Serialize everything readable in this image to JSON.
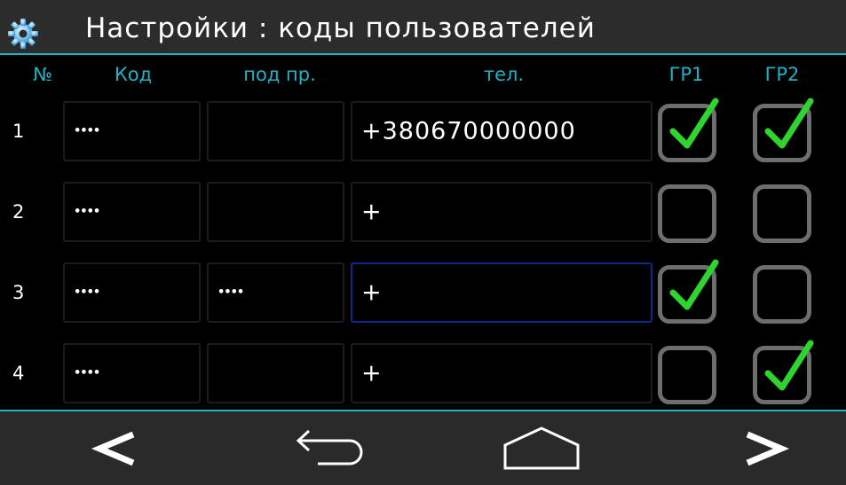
{
  "header": {
    "title": "Настройки : коды пользователей",
    "icon": "gear-icon"
  },
  "columns": {
    "num": "№",
    "code": "Код",
    "duress": "под пр.",
    "phone": "тел.",
    "gr1": "ГР1",
    "gr2": "ГР2"
  },
  "rows": [
    {
      "num": "1",
      "code": "••••",
      "duress": "",
      "phone": "+380670000000",
      "gr1": true,
      "gr2": true
    },
    {
      "num": "2",
      "code": "••••",
      "duress": "",
      "phone": "+",
      "gr1": false,
      "gr2": false
    },
    {
      "num": "3",
      "code": "••••",
      "duress": "••••",
      "phone": "+",
      "gr1": true,
      "gr2": false
    },
    {
      "num": "4",
      "code": "••••",
      "duress": "",
      "phone": "+",
      "gr1": false,
      "gr2": true
    }
  ],
  "navbar": {
    "prev": "chevron-left-icon",
    "back": "back-arrow-icon",
    "home": "home-icon",
    "next": "chevron-right-icon"
  },
  "colors": {
    "accent": "#1fb3c4",
    "check": "#2fd42f",
    "checkbox_border": "#6e6e6e",
    "active_field_border": "#0b2a8a"
  }
}
